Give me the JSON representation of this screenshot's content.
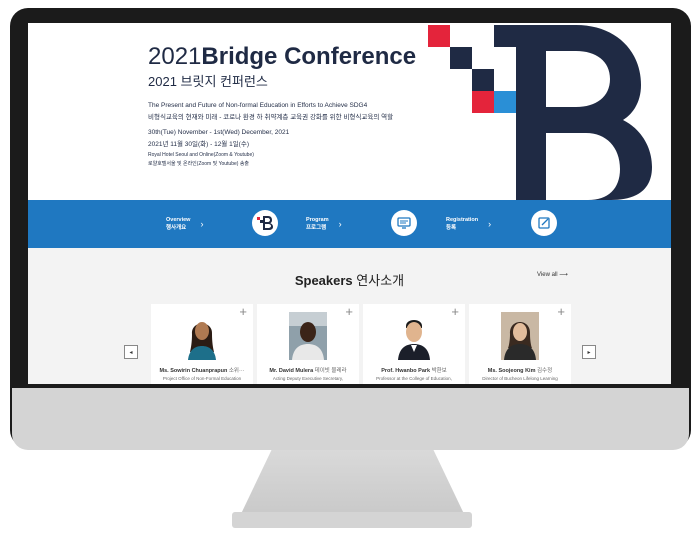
{
  "conference": {
    "year": "2021",
    "name": "Bridge Conference",
    "subtitle_ko": "2021 브릿지 컨퍼런스",
    "description_en": "The Present and Future of Non-formal Education in Efforts to Achieve SDG4",
    "description_ko": "비형식교육의 현재와 미래 - 코로나 환경 하 취약계층 교육권 강화를 위한 비형식교육의 역할",
    "date_en": "30th(Tue) November - 1st(Wed) December, 2021",
    "date_ko": "2021년 11월 30일(화) - 12월 1일(수)",
    "venue_en": "Royal Hotel Seoul and Online(Zoom & Youtube)",
    "venue_ko": "로얄호텔서울 및 온라인(Zoom 및 Youtube) 송출"
  },
  "nav": [
    {
      "label_en": "Overview",
      "label_ko": "행사개요",
      "icon": "bridge-logo-icon"
    },
    {
      "label_en": "Program",
      "label_ko": "프로그램",
      "icon": "monitor-icon"
    },
    {
      "label_en": "Registration",
      "label_ko": "등록",
      "icon": "edit-form-icon"
    }
  ],
  "nav_chevron": "›",
  "speakers": {
    "heading_en": "Speakers",
    "heading_ko": "연사소개",
    "view_all": "View all ⟶",
    "prev": "◂",
    "next": "▸",
    "plus": "+",
    "items": [
      {
        "name": "Ms. Sowirin Chuanprapun",
        "name_ko": "소위···",
        "role": "Project Office of Non-Formal Education"
      },
      {
        "name": "Mr. David Mulera",
        "name_ko": "데이빗 물레라",
        "role": "Acting Deputy Executive Secretary,"
      },
      {
        "name": "Prof. Hwanbo Park",
        "name_ko": "박환보",
        "role": "Professor at the College of Education,"
      },
      {
        "name": "Ms. Soojeong Kim",
        "name_ko": "김수정",
        "role": "Director of Bucheon Lifelong Learning"
      }
    ]
  },
  "colors": {
    "navy": "#1f2a44",
    "blue": "#1f78c1",
    "red": "#e4243b",
    "light_blue": "#2a8fd6"
  }
}
